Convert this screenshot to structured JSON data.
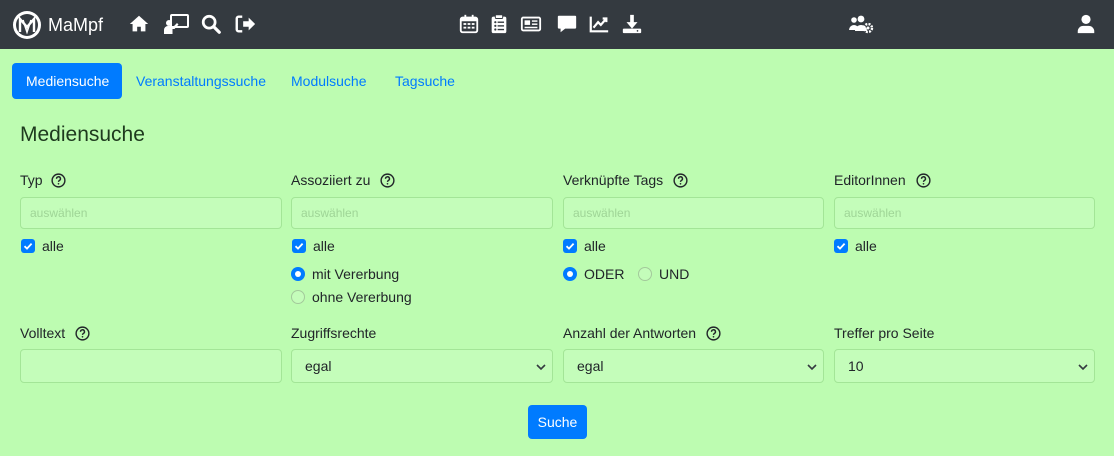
{
  "navbar": {
    "brand": "MaMpf",
    "icons": [
      "home-icon",
      "lecture-board-icon",
      "search-icon",
      "logout-icon",
      "calendar-icon",
      "clipboard-icon",
      "newspaper-icon",
      "comment-icon",
      "chart-line-icon",
      "download-icon",
      "users-cog-icon",
      "user-icon"
    ]
  },
  "tabs": [
    "Mediensuche",
    "Veranstaltungssuche",
    "Modulsuche",
    "Tagsuche"
  ],
  "page_title": "Mediensuche",
  "filters": {
    "typ": {
      "label": "Typ",
      "placeholder": "auswählen",
      "all_label": "alle"
    },
    "assoziiert": {
      "label": "Assoziiert zu",
      "placeholder": "auswählen",
      "all_label": "alle",
      "option_with": "mit Vererbung",
      "option_without": "ohne Vererbung"
    },
    "tags": {
      "label": "Verknüpfte Tags",
      "placeholder": "auswählen",
      "all_label": "alle",
      "option_or": "ODER",
      "option_and": "UND"
    },
    "editors": {
      "label": "EditorInnen",
      "placeholder": "auswählen",
      "all_label": "alle"
    }
  },
  "second_row": {
    "volltext": {
      "label": "Volltext",
      "value": ""
    },
    "zugriff": {
      "label": "Zugriffsrechte",
      "value": "egal"
    },
    "antworten": {
      "label": "Anzahl der Antworten",
      "value": "egal"
    },
    "treffer": {
      "label": "Treffer pro Seite",
      "value": "10"
    }
  },
  "search_button": "Suche",
  "colors": {
    "background": "#bdfcb1",
    "navbar": "#343a40",
    "accent": "#007bff",
    "field": "#c4fdba"
  }
}
